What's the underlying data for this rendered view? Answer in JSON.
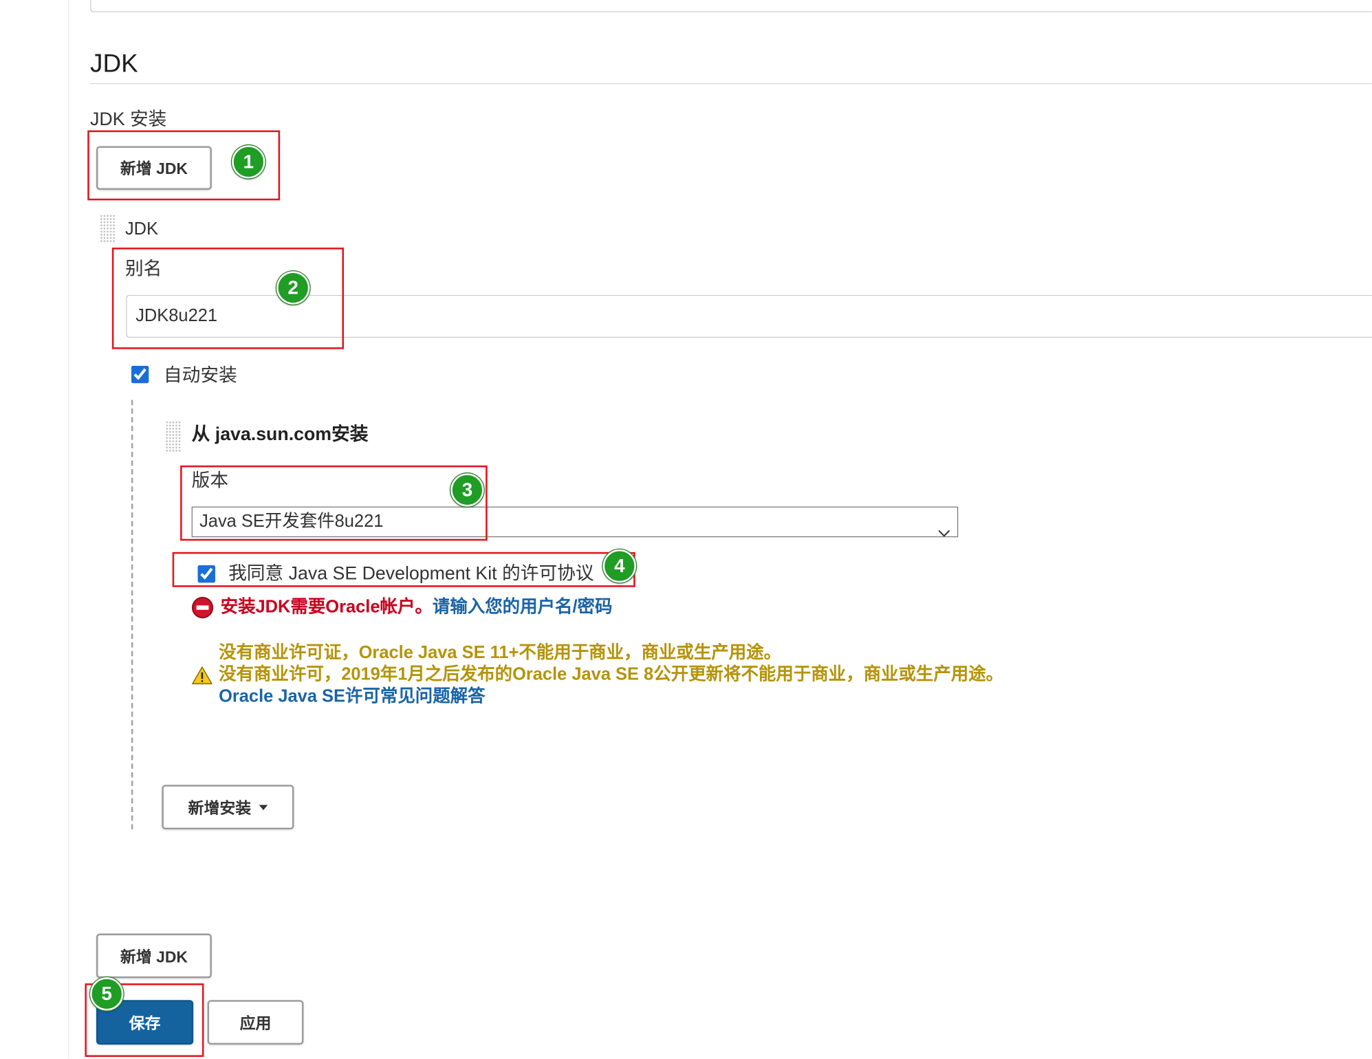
{
  "colors": {
    "annotation": "#e3141e",
    "marker": "#1f9d24",
    "primary": "#14639f",
    "error": "#c8001e",
    "warning": "#b5940a",
    "link": "#1b64a6",
    "checkbox": "#1a6ed8"
  },
  "icons": {
    "drag": "drag-handle-icon",
    "select": "chevron-down-icon",
    "error": "error-circle-icon",
    "warning": "warning-triangle-icon",
    "dropdown": "caret-down-icon"
  },
  "section": {
    "title": "JDK"
  },
  "jdk_install": {
    "label": "JDK 安装",
    "add_jdk_top": "新增 JDK",
    "item": {
      "title": "JDK",
      "alias": {
        "label": "别名",
        "value": "JDK8u221"
      },
      "auto_install": {
        "label": "自动安装",
        "checked": true
      },
      "installer": {
        "title": "从 java.sun.com安装",
        "version": {
          "label": "版本",
          "selected": "Java SE开发套件8u221"
        },
        "license": {
          "label": "我同意 Java SE Development Kit 的许可协议",
          "checked": true
        },
        "error": {
          "message": "安装JDK需要Oracle帐户。",
          "link": "请输入您的用户名/密码"
        },
        "warning": {
          "lines": [
            "没有商业许可证，Oracle Java SE 11+不能用于商业，商业或生产用途。",
            "没有商业许可，2019年1月之后发布的Oracle Java SE 8公开更新将不能用于商业，商业或生产用途。"
          ],
          "link": "Oracle Java SE许可常见问题解答"
        }
      },
      "add_installer": "新增安装"
    },
    "add_jdk_bottom": "新增 JDK"
  },
  "actions": {
    "save": "保存",
    "apply": "应用"
  },
  "annotations": {
    "markers": [
      "1",
      "2",
      "3",
      "4",
      "5"
    ]
  }
}
